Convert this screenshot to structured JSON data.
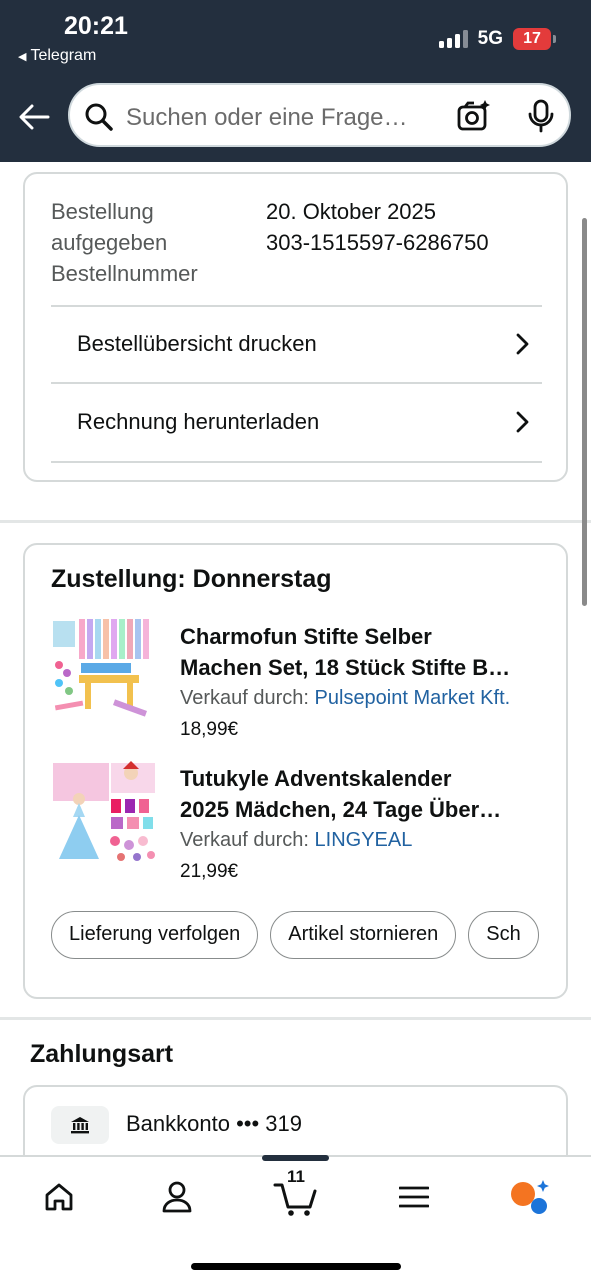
{
  "status_bar": {
    "time": "20:21",
    "back_app": "Telegram",
    "network": "5G",
    "battery": "17"
  },
  "search": {
    "placeholder": "Suchen oder eine Frage…"
  },
  "order": {
    "labels": [
      "Bestellung",
      "aufgegeben",
      "Bestellnummer"
    ],
    "date": "20. Oktober 2025",
    "number": "303-1515597-6286750",
    "print_label": "Bestellübersicht drucken",
    "invoice_label": "Rechnung herunterladen"
  },
  "delivery": {
    "title": "Zustellung: Donnerstag",
    "items": [
      {
        "title_line1": "Charmofun Stifte Selber",
        "title_line2": "Machen Set, 18 Stück Stifte B…",
        "seller_prefix": "Verkauf durch: ",
        "seller": "Pulsepoint Market Kft.",
        "price": "18,99€"
      },
      {
        "title_line1": "Tutukyle Adventskalender",
        "title_line2": "2025 Mädchen, 24 Tage Über…",
        "seller_prefix": "Verkauf durch: ",
        "seller": "LINGYEAL",
        "price": "21,99€"
      }
    ],
    "actions": [
      "Lieferung verfolgen",
      "Artikel stornieren",
      "Sch"
    ]
  },
  "payment": {
    "title": "Zahlungsart",
    "method": "Bankkonto ••• 319"
  },
  "tabbar": {
    "cart_count": "11"
  },
  "colors": {
    "header_bg": "#232f3e",
    "link": "#2162a1",
    "battery_low": "#e33b3b"
  }
}
